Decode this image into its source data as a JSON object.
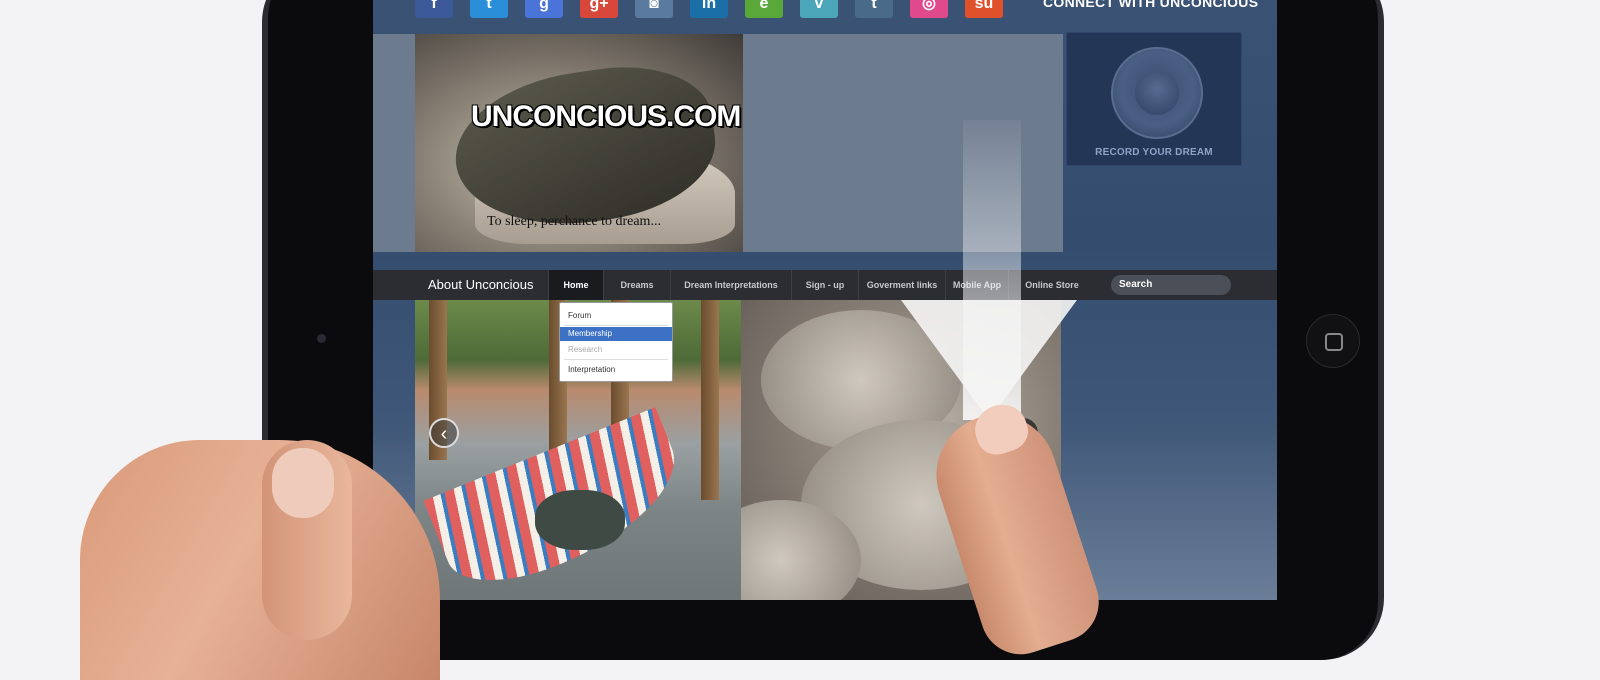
{
  "social": {
    "connect_label": "CONNECT WITH UNCONCIOUS",
    "icons": [
      {
        "name": "facebook-icon",
        "glyph": "f",
        "color": "#3b5998"
      },
      {
        "name": "twitter-icon",
        "glyph": "t",
        "color": "#2a8fd8"
      },
      {
        "name": "google-icon",
        "glyph": "g",
        "color": "#4a74d8"
      },
      {
        "name": "google-plus-icon",
        "glyph": "g+",
        "color": "#d8473a"
      },
      {
        "name": "instagram-icon",
        "glyph": "◙",
        "color": "#5a7aa0"
      },
      {
        "name": "linkedin-icon",
        "glyph": "in",
        "color": "#1a6fa8"
      },
      {
        "name": "evernote-icon",
        "glyph": "e",
        "color": "#5aa83a"
      },
      {
        "name": "vimeo-icon",
        "glyph": "v",
        "color": "#4aa6b8"
      },
      {
        "name": "tumblr-icon",
        "glyph": "t",
        "color": "#4a6a8a"
      },
      {
        "name": "dribbble-icon",
        "glyph": "◎",
        "color": "#e04a8c"
      },
      {
        "name": "stumbleupon-icon",
        "glyph": "su",
        "color": "#e0502a"
      }
    ]
  },
  "hero": {
    "title": "UNCONCIOUS.COM",
    "tagline": "To sleep, perchance to dream..."
  },
  "record": {
    "label": "RECORD YOUR DREAM"
  },
  "nav": {
    "brand": "About Unconcious",
    "items": [
      "Home",
      "Dreams",
      "Dream Interpretations",
      "Sign - up",
      "Goverment links",
      "Mobile App",
      "Online Store"
    ],
    "search_placeholder": "Search"
  },
  "dropdown": {
    "items": [
      "Forum",
      "Membership",
      "Research",
      "Interpretation"
    ]
  },
  "slider": {
    "prev_glyph": "‹",
    "next_glyph": "›"
  },
  "colors": {
    "screen_bg": "#344c6e",
    "nav_bg": "#2b2d33",
    "dropdown_selected": "#3c71c6"
  }
}
